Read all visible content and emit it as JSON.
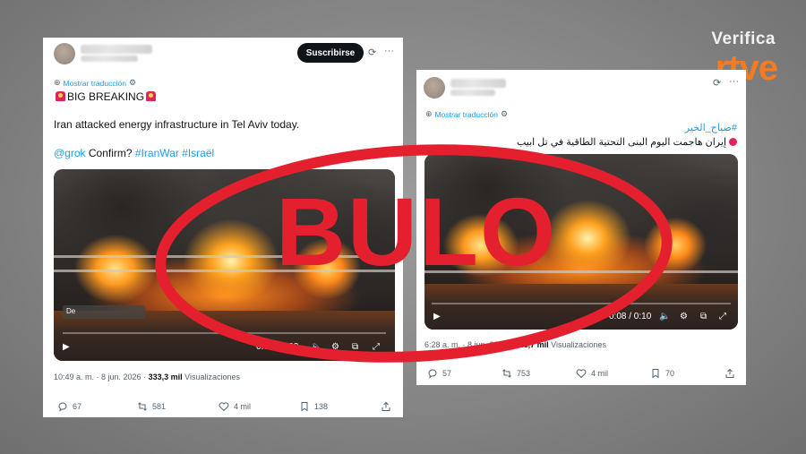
{
  "brand": {
    "verifica": "Verifica",
    "rtve": "rtve"
  },
  "stamp": {
    "text": "BULO",
    "color": "#e5202e"
  },
  "tweet1": {
    "follow_label": "Suscribirse",
    "translate_label": "Mostrar traducción",
    "heading": "BIG BREAKING",
    "line1": "Iran attacked energy infrastructure in Tel Aviv today.",
    "mention": "@grok",
    "confirm": "Confirm?",
    "tag1": "#IranWar",
    "tag2": "#Israël",
    "video_label": "De",
    "video_time": "0:03 / 0:22",
    "timestamp": "10:49 a. m. · 8 jun. 2026 · ",
    "views_count": "333,3 mil",
    "views_label": "Visualizaciones",
    "replies": "67",
    "reposts": "581",
    "likes": "4 mil",
    "bookmarks": "138"
  },
  "tweet2": {
    "translate_label": "Mostrar traducción",
    "hashtag": "#صباح_الخير",
    "body": "إيران هاجمت اليوم البنى التحتية الطاقية في تل ابيب",
    "video_time": "0:08 / 0:10",
    "timestamp": "6:28 a. m. · 8 jun. 2026 · ",
    "views_count": "128,7 mil",
    "views_label": "Visualizaciones",
    "replies": "57",
    "reposts": "753",
    "likes": "4 mil",
    "bookmarks": "70"
  },
  "colors": {
    "accent": "#1d9bf0",
    "brand_orange": "#f47b20",
    "stamp_red": "#e5202e"
  }
}
